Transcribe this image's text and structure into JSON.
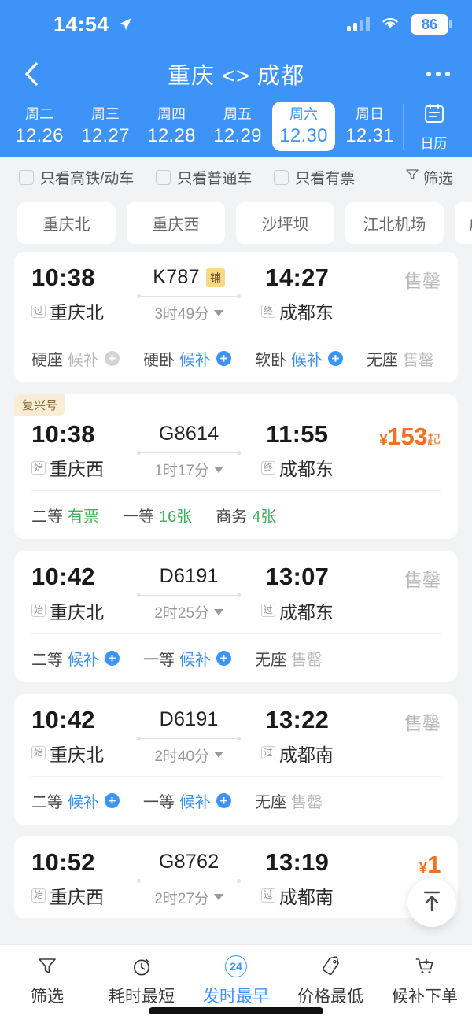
{
  "status_bar": {
    "time": "14:54",
    "location_icon": "location-arrow-icon",
    "signal_icon": "cellular-signal-icon",
    "wifi_icon": "wifi-icon",
    "battery_level": "86"
  },
  "nav": {
    "back_icon": "chevron-left-icon",
    "title": "重庆 <> 成都",
    "more_icon": "more-horizontal-icon"
  },
  "dates": [
    {
      "dow": "周二",
      "date": "12.26",
      "active": false
    },
    {
      "dow": "周三",
      "date": "12.27",
      "active": false
    },
    {
      "dow": "周四",
      "date": "12.28",
      "active": false
    },
    {
      "dow": "周五",
      "date": "12.29",
      "active": false
    },
    {
      "dow": "周六",
      "date": "12.30",
      "active": true
    },
    {
      "dow": "周日",
      "date": "12.31",
      "active": false
    }
  ],
  "calendar_button": {
    "label": "日历",
    "icon": "calendar-icon"
  },
  "filters": {
    "checkboxes": [
      {
        "label": "只看高铁/动车",
        "checked": false
      },
      {
        "label": "只看普通车",
        "checked": false
      },
      {
        "label": "只看有票",
        "checked": false
      }
    ],
    "filter_button": {
      "label": "筛选",
      "icon": "funnel-icon"
    }
  },
  "station_chips": [
    "重庆北",
    "重庆西",
    "沙坪坝",
    "江北机场",
    "成"
  ],
  "trains": [
    {
      "tag": null,
      "depart_time": "10:38",
      "depart_station": "重庆北",
      "depart_mark": "过",
      "train_no": "K787",
      "train_badge": "铺",
      "duration": "3时49分",
      "arrive_time": "14:27",
      "arrive_station": "成都东",
      "arrive_mark": "终",
      "price": null,
      "status": "售罄",
      "seats": [
        {
          "label": "硬座",
          "value": "候补",
          "style": "grey",
          "plus": "grey"
        },
        {
          "label": "硬卧",
          "value": "候补",
          "style": "blue",
          "plus": "blue"
        },
        {
          "label": "软卧",
          "value": "候补",
          "style": "blue",
          "plus": "blue"
        },
        {
          "label": "无座",
          "value": "售罄",
          "style": "grey",
          "plus": null
        }
      ]
    },
    {
      "tag": "复兴号",
      "depart_time": "10:38",
      "depart_station": "重庆西",
      "depart_mark": "始",
      "train_no": "G8614",
      "train_badge": null,
      "duration": "1时17分",
      "arrive_time": "11:55",
      "arrive_station": "成都东",
      "arrive_mark": "终",
      "price": {
        "currency": "¥",
        "amount": "153",
        "suffix": "起"
      },
      "status": null,
      "seats": [
        {
          "label": "二等",
          "value": "有票",
          "style": "green",
          "plus": null
        },
        {
          "label": "一等",
          "value": "16张",
          "style": "green",
          "plus": null
        },
        {
          "label": "商务",
          "value": "4张",
          "style": "green",
          "plus": null
        }
      ]
    },
    {
      "tag": null,
      "depart_time": "10:42",
      "depart_station": "重庆北",
      "depart_mark": "始",
      "train_no": "D6191",
      "train_badge": null,
      "duration": "2时25分",
      "arrive_time": "13:07",
      "arrive_station": "成都东",
      "arrive_mark": "过",
      "price": null,
      "status": "售罄",
      "seats": [
        {
          "label": "二等",
          "value": "候补",
          "style": "blue",
          "plus": "blue"
        },
        {
          "label": "一等",
          "value": "候补",
          "style": "blue",
          "plus": "blue"
        },
        {
          "label": "无座",
          "value": "售罄",
          "style": "grey",
          "plus": null
        }
      ]
    },
    {
      "tag": null,
      "depart_time": "10:42",
      "depart_station": "重庆北",
      "depart_mark": "始",
      "train_no": "D6191",
      "train_badge": null,
      "duration": "2时40分",
      "arrive_time": "13:22",
      "arrive_station": "成都南",
      "arrive_mark": "过",
      "price": null,
      "status": "售罄",
      "seats": [
        {
          "label": "二等",
          "value": "候补",
          "style": "blue",
          "plus": "blue"
        },
        {
          "label": "一等",
          "value": "候补",
          "style": "blue",
          "plus": "blue"
        },
        {
          "label": "无座",
          "value": "售罄",
          "style": "grey",
          "plus": null
        }
      ]
    },
    {
      "tag": null,
      "depart_time": "10:52",
      "depart_station": "重庆西",
      "depart_mark": "始",
      "train_no": "G8762",
      "train_badge": null,
      "duration": "2时27分",
      "arrive_time": "13:19",
      "arrive_station": "成都南",
      "arrive_mark": "过",
      "price": {
        "currency": "¥",
        "amount": "1",
        "suffix": ""
      },
      "status": null,
      "seats": []
    }
  ],
  "scroll_top_button": {
    "icon": "arrow-up-to-line-icon"
  },
  "bottom_nav": [
    {
      "label": "筛选",
      "icon": "funnel-icon",
      "active": false,
      "badge": null
    },
    {
      "label": "耗时最短",
      "icon": "stopwatch-icon",
      "active": false,
      "badge": null
    },
    {
      "label": "发时最早",
      "icon": "clock-24-icon",
      "active": true,
      "badge": "24"
    },
    {
      "label": "价格最低",
      "icon": "price-tag-icon",
      "active": false,
      "badge": null
    },
    {
      "label": "候补下单",
      "icon": "shopping-cart-icon",
      "active": false,
      "badge": null
    }
  ],
  "colors": {
    "brand_blue": "#3d93f7",
    "price_orange": "#f4701f",
    "available_green": "#3fb15a",
    "muted_grey": "#b9b9b9",
    "page_bg": "#f2f3f5"
  }
}
